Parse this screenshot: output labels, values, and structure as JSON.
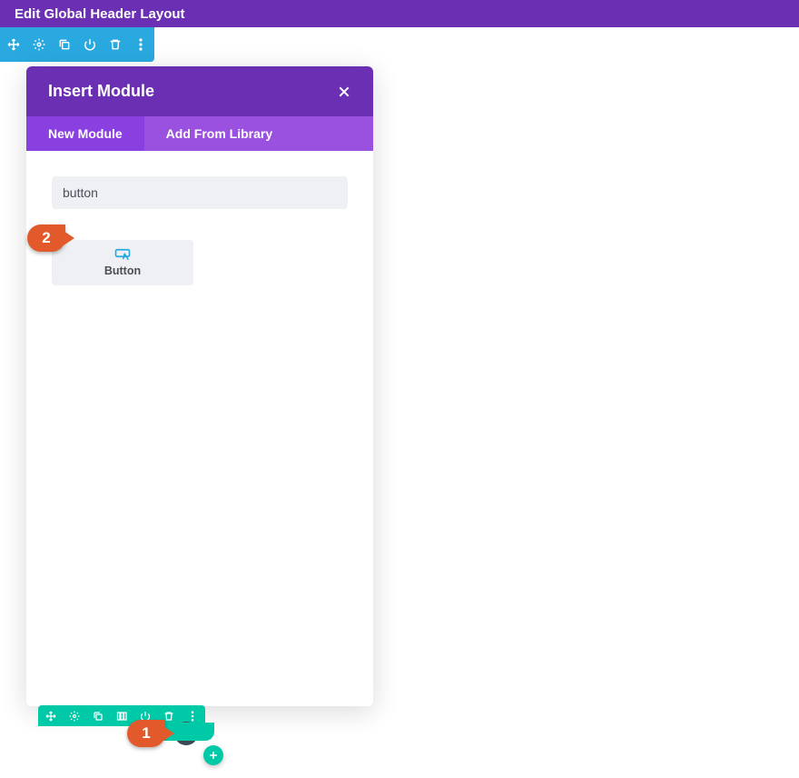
{
  "header": {
    "title": "Edit Global Header Layout"
  },
  "section_toolbar": {
    "items": [
      "move",
      "settings",
      "duplicate",
      "power",
      "delete",
      "more"
    ]
  },
  "modal": {
    "title": "Insert Module",
    "close_label": "×",
    "tabs": [
      {
        "label": "New Module",
        "active": true
      },
      {
        "label": "Add From Library",
        "active": false
      }
    ],
    "search_value": "button",
    "modules": [
      {
        "name": "Button"
      }
    ]
  },
  "row_toolbar": {
    "items": [
      "move",
      "settings",
      "duplicate",
      "columns",
      "power",
      "delete",
      "more"
    ]
  },
  "annotations": {
    "step1": "1",
    "step2": "2"
  },
  "colors": {
    "purple": "#6b2fb3",
    "purple_light": "#9b51e0",
    "blue": "#29a9e0",
    "teal": "#00c9a7",
    "orange": "#e25a2b"
  }
}
